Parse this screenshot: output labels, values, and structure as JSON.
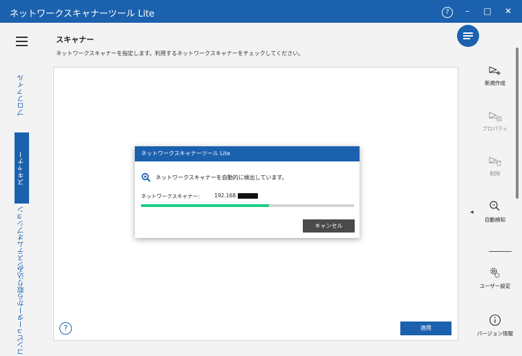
{
  "app": {
    "title": "ネットワークスキャナーツール Lite"
  },
  "titlebar": {
    "help_icon": "help-circle-icon",
    "help_glyph": "?",
    "minimize_glyph": "–",
    "maximize_glyph": "□",
    "close_glyph": "✕"
  },
  "leftnav": {
    "items": [
      {
        "label": "プロファイル",
        "active": false
      },
      {
        "label": "スキャナー",
        "active": true
      },
      {
        "label": "システムオプション",
        "active": false
      },
      {
        "label": "コンピューターから取り込み",
        "active": false
      }
    ]
  },
  "main": {
    "title": "スキャナー",
    "description": "ネットワークスキャナーを指定します。利用するネットワークスキャナーをチェックしてください。",
    "apply_label": "適用",
    "help_glyph": "?"
  },
  "dialog": {
    "title": "ネットワークスキャナーツール Lite",
    "message": "ネットワークスキャナーを自動的に検出しています。",
    "scanner_label": "ネットワークスキャナー:",
    "scanner_ip_prefix": "192.168.",
    "progress_fraction": 0.6,
    "cancel_label": "キャンセル"
  },
  "toolbar": {
    "items": [
      {
        "label": "新規作成",
        "icon": "new-scanner-icon",
        "enabled": true
      },
      {
        "label": "プロパティ",
        "icon": "properties-icon",
        "enabled": false
      },
      {
        "label": "削除",
        "icon": "delete-icon",
        "enabled": false
      },
      {
        "label": "自動検知",
        "icon": "auto-detect-icon",
        "enabled": true
      },
      {
        "label": "ユーザー設定",
        "icon": "user-settings-icon",
        "enabled": true
      },
      {
        "label": "バージョン情報",
        "icon": "info-icon",
        "enabled": true
      }
    ]
  },
  "colors": {
    "accent": "#1b61ae",
    "progress": "#1ccd87",
    "button_dark": "#4a4a4a"
  }
}
